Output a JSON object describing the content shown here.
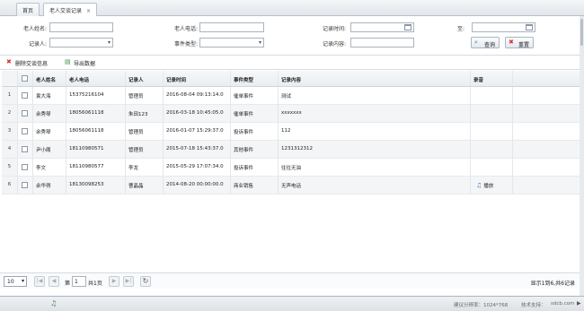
{
  "tabs": [
    {
      "label": "首页"
    },
    {
      "label": "老人交谈记录",
      "close": "×"
    }
  ],
  "form": {
    "name_label": "老人姓名:",
    "phone_label": "老人电话:",
    "time_label": "记录时间:",
    "to_label": "至:",
    "recorder_label": "记录人:",
    "event_type_label": "事件类型:",
    "content_label": "记录内容:",
    "search_label": "查询",
    "reset_label": "重置"
  },
  "toolbar": {
    "delete_label": "删除交谈信息",
    "export_label": "导出数据"
  },
  "table": {
    "headers": [
      "老人姓名",
      "老人电话",
      "记录人",
      "记录时间",
      "事件类型",
      "记录内容",
      "录音"
    ],
    "rows": [
      {
        "num": "1",
        "name": "袁大海",
        "phone": "15375216104",
        "recorder": "管理员",
        "time": "2016-08-04 09:13:14.0",
        "type": "催单事件",
        "content": "测试",
        "audio": ""
      },
      {
        "num": "2",
        "name": "余秀琴",
        "phone": "18056061118",
        "recorder": "朱田123",
        "time": "2016-03-18 10:45:05.0",
        "type": "催单事件",
        "content": "xxxxxxx",
        "audio": ""
      },
      {
        "num": "3",
        "name": "余秀琴",
        "phone": "18056061118",
        "recorder": "管理员",
        "time": "2016-01-07 15:29:37.0",
        "type": "投诉事件",
        "content": "112",
        "audio": ""
      },
      {
        "num": "4",
        "name": "尹小阁",
        "phone": "18110980571",
        "recorder": "管理员",
        "time": "2015-07-18 15:43:37.0",
        "type": "其他事件",
        "content": "1231312312",
        "audio": ""
      },
      {
        "num": "5",
        "name": "李文",
        "phone": "18110980577",
        "recorder": "李龙",
        "time": "2015-05-29 17:07:34.0",
        "type": "投诉事件",
        "content": "往往无油",
        "audio": ""
      },
      {
        "num": "6",
        "name": "余华得",
        "phone": "18130098253",
        "recorder": "曹晶晶",
        "time": "2014-08-20 00:00:00.0",
        "type": "商业销售",
        "content": "无声电话",
        "audio": "播放"
      }
    ]
  },
  "pager": {
    "page_size": "10",
    "page_prefix": "第",
    "page_value": "1",
    "page_suffix": "共1页",
    "info": "显示1到6,共6记录"
  },
  "footer": {
    "resolution": "建议分辨率：1024*768",
    "support": "技术支持：",
    "company": "sdcb.com"
  },
  "colors": {
    "accent": "#2f7cc1",
    "delete": "#d9342b",
    "audio": "#3b7fc4"
  },
  "icons": [
    "close-icon",
    "calendar-icon",
    "search-icon",
    "reset-icon",
    "delete-icon",
    "export-icon",
    "audio-icon",
    "refresh-icon",
    "bell-icon"
  ]
}
